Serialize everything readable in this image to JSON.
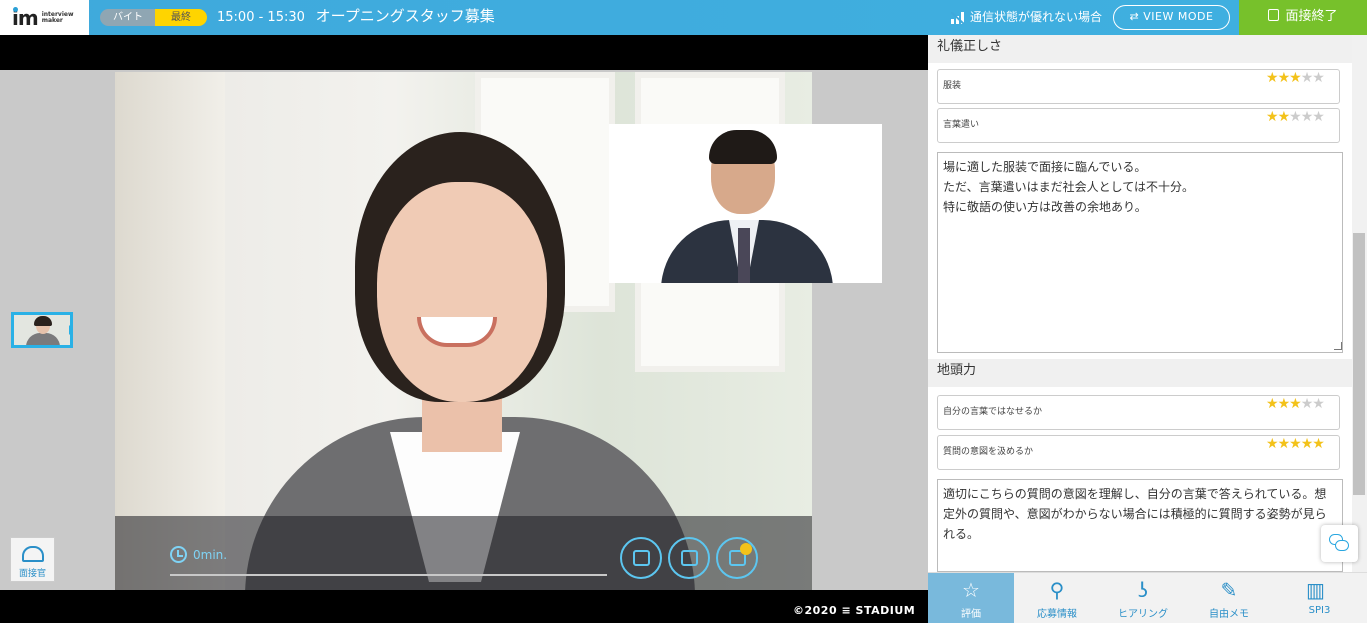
{
  "header": {
    "logo_text": "im",
    "logo_sub": "interview maker",
    "tag_part_time": "バイト",
    "tag_final": "最終",
    "time": "15:00 - 15:30",
    "title": "オープニングスタッフ募集",
    "poor_connection": "通信状態が優れない場合",
    "view_mode": "VIEW MODE",
    "end_interview": "面接終了"
  },
  "stage": {
    "timer": "0min.",
    "interviewer_label": "面接官",
    "copyright": "©2020",
    "brand": "STADIUM"
  },
  "panel": {
    "sections": [
      {
        "heading": "礼儀正しさ",
        "items": [
          {
            "label": "服装",
            "rating": 3,
            "max": 5
          },
          {
            "label": "言葉遣い",
            "rating": 2,
            "max": 5
          }
        ],
        "memo": "場に適した服装で面接に臨んでいる。\nただ、言葉遣いはまだ社会人としては不十分。\n特に敬語の使い方は改善の余地あり。"
      },
      {
        "heading": "地頭力",
        "items": [
          {
            "label": "自分の言葉ではなせるか",
            "rating": 3,
            "max": 5
          },
          {
            "label": "質問の意図を汲めるか",
            "rating": 5,
            "max": 5
          }
        ],
        "memo": "適切にこちらの質問の意図を理解し、自分の言葉で答えられている。想定外の質問や、意図がわからない場合には積極的に質問する姿勢が見られる。"
      }
    ]
  },
  "tabs": [
    {
      "label": "評価",
      "icon": "star-icon",
      "active": true
    },
    {
      "label": "応募情報",
      "icon": "person-icon",
      "active": false
    },
    {
      "label": "ヒアリング",
      "icon": "ear-icon",
      "active": false
    },
    {
      "label": "自由メモ",
      "icon": "edit-icon",
      "active": false
    },
    {
      "label": "SPI3",
      "icon": "bar-chart-icon",
      "active": false
    }
  ],
  "colors": {
    "header_blue": "#3fa9dc",
    "end_green": "#77c12b",
    "star_yellow": "#f3c21a",
    "accent_cyan": "#2ab1e6"
  }
}
